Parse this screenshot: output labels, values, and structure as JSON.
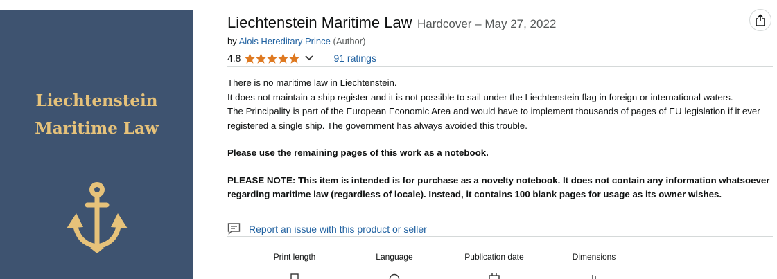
{
  "cover": {
    "title_line1": "Liechtenstein",
    "title_line2": "Maritime Law",
    "background": "#3e5370",
    "accent": "#e6c27a",
    "emblem": "anchor-icon"
  },
  "product": {
    "title": "Liechtenstein Maritime Law",
    "format": "Hardcover – May 27, 2022",
    "by_prefix": "by",
    "author": "Alois Hereditary Prince",
    "author_role": "(Author)",
    "rating_value": "4.8",
    "stars_filled": 5,
    "ratings_count": "91 ratings"
  },
  "description": {
    "line1": "There is no maritime law in Liechtenstein.",
    "line2": "It does not maintain a ship register and it is not possible to sail under the Liechtenstein flag in foreign or international waters.",
    "line3": "The Principality is part of the European Economic Area and would have to implement thousands of pages of EU legislation if it ever registered a single ship. The government has always avoided this trouble.",
    "notebook_note": "Please use the remaining pages of this work as a notebook.",
    "please_note": "PLEASE NOTE: This item is intended is for purchase as a novelty notebook. It does not contain any information whatsoever regarding maritime law (regardless of locale). Instead, it contains 100 blank pages for usage as its owner wishes."
  },
  "report_link": "Report an issue with this product or seller",
  "details": [
    {
      "label": "Print length",
      "icon": "book-icon"
    },
    {
      "label": "Language",
      "icon": "globe-icon"
    },
    {
      "label": "Publication date",
      "icon": "calendar-icon"
    },
    {
      "label": "Dimensions",
      "icon": "ruler-icon"
    }
  ],
  "colors": {
    "link": "#2162a1",
    "star": "#de7921",
    "text": "#0f1111",
    "muted": "#565959"
  },
  "share_icon": "share-icon"
}
